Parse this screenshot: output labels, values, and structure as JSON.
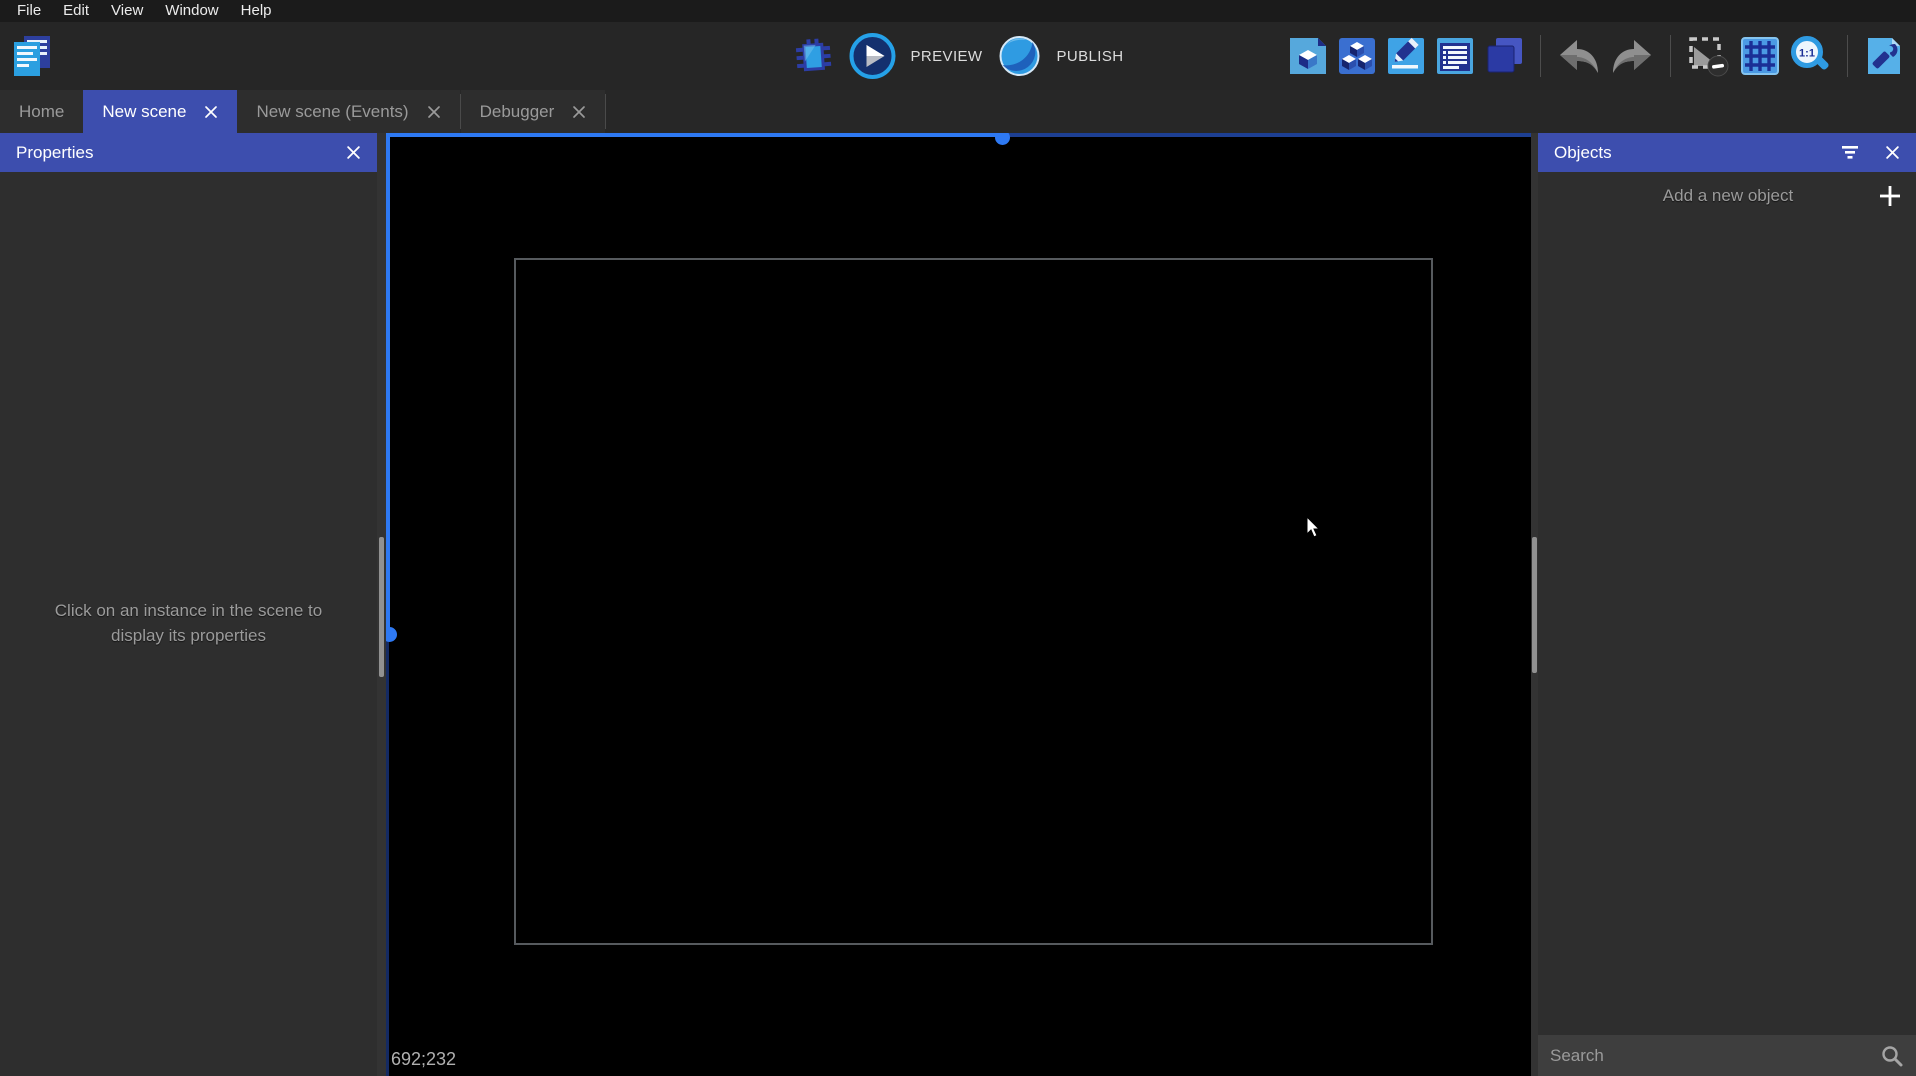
{
  "menu": {
    "items": [
      "File",
      "Edit",
      "View",
      "Window",
      "Help"
    ]
  },
  "toolbar": {
    "preview_label": "PREVIEW",
    "publish_label": "PUBLISH",
    "zoom_ratio_label": "1:1",
    "icons": [
      "project-manager",
      "debug-bug",
      "preview-play",
      "publish-sphere",
      "scene-properties",
      "objects-list",
      "edit-scene",
      "instances-list",
      "layers",
      "undo",
      "redo",
      "clear-selection",
      "grid",
      "zoom-1-1",
      "setup-wrench"
    ]
  },
  "tabs": {
    "items": [
      {
        "label": "Home",
        "active": false,
        "closable": false
      },
      {
        "label": "New scene",
        "active": true,
        "closable": true
      },
      {
        "label": "New scene (Events)",
        "active": false,
        "closable": true
      },
      {
        "label": "Debugger",
        "active": false,
        "closable": true
      }
    ]
  },
  "properties_panel": {
    "title": "Properties",
    "empty_hint": "Click on an instance in the scene to display its properties"
  },
  "objects_panel": {
    "title": "Objects",
    "add_button_label": "Add a new object",
    "search_placeholder": "Search"
  },
  "canvas": {
    "mouse_coordinates": "692;232"
  },
  "colors": {
    "accent_header": "#3d4eae",
    "selection_blue": "#2e79f3",
    "icon_blue": "#2f9be2",
    "canvas_background": "#000000"
  }
}
